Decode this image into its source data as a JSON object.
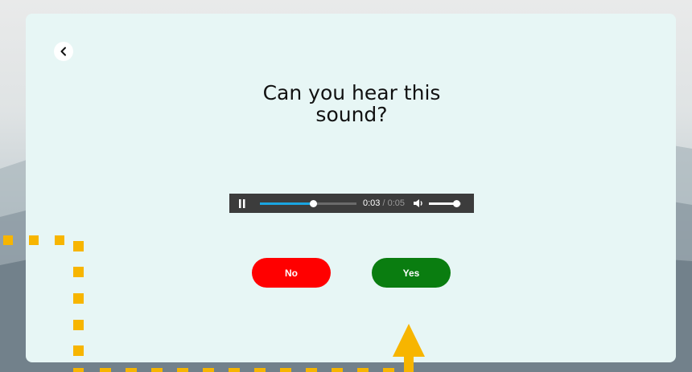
{
  "page": {
    "title_text": "Can you hear this\nsound?",
    "back_icon": "chevron-left-icon"
  },
  "player": {
    "state": "playing",
    "current_time": "0:03",
    "separator": "/",
    "duration": "0:05",
    "progress_fraction": 0.55,
    "volume_fraction": 0.85,
    "accent_color": "#1aa5e0"
  },
  "buttons": {
    "no_label": "No",
    "yes_label": "Yes",
    "no_color": "#ff0000",
    "yes_color": "#0a7d10"
  },
  "overlay": {
    "guide_color": "#f7b500",
    "guide_style": "dashed-path-with-arrow"
  }
}
